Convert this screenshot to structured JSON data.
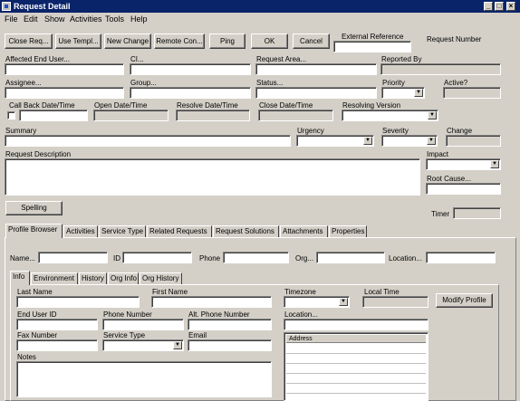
{
  "window": {
    "title": "Request Detail"
  },
  "menu": [
    "File",
    "Edit",
    "Show",
    "Activities",
    "Tools",
    "Help"
  ],
  "toolbar": {
    "close_req": "Close Req...",
    "use_templ": "Use Templ...",
    "new_change": "New Change",
    "remote_con": "Remote Con...",
    "ping": "Ping",
    "ok": "OK",
    "cancel": "Cancel",
    "external_reference": "External Reference",
    "request_number": "Request Number"
  },
  "fields": {
    "affected_end_user": "Affected End User...",
    "ci": "CI...",
    "request_area": "Request Area...",
    "reported_by": "Reported By",
    "assignee": "Assignee...",
    "group": "Group...",
    "status": "Status...",
    "priority": "Priority",
    "active": "Active?",
    "call_back": "Call Back Date/Time",
    "open_date": "Open Date/Time",
    "resolve_date": "Resolve Date/Time",
    "close_date": "Close Date/Time",
    "resolving_version": "Resolving Version",
    "summary": "Summary",
    "urgency": "Urgency",
    "severity": "Severity",
    "change": "Change",
    "request_description": "Request Description",
    "impact": "Impact",
    "root_cause": "Root Cause...",
    "spelling": "Spelling",
    "timer": "Timer"
  },
  "tabs": [
    "Profile Browser",
    "Activities",
    "Service Type",
    "Related Requests",
    "Request Solutions",
    "Attachments",
    "Properties"
  ],
  "profile": {
    "name": "Name...",
    "id": "ID",
    "phone": "Phone",
    "org": "Org...",
    "location": "Location..."
  },
  "subtabs": [
    "Info",
    "Environment",
    "History",
    "Org Info",
    "Org History"
  ],
  "info": {
    "last_name": "Last Name",
    "first_name": "First Name",
    "timezone": "Timezone",
    "local_time": "Local Time",
    "modify_profile": "Modify Profile",
    "end_user_id": "End User ID",
    "phone_number": "Phone Number",
    "alt_phone": "Alt. Phone Number",
    "location": "Location...",
    "fax_number": "Fax Number",
    "service_type": "Service Type",
    "email": "Email",
    "address": "Address",
    "notes": "Notes"
  }
}
